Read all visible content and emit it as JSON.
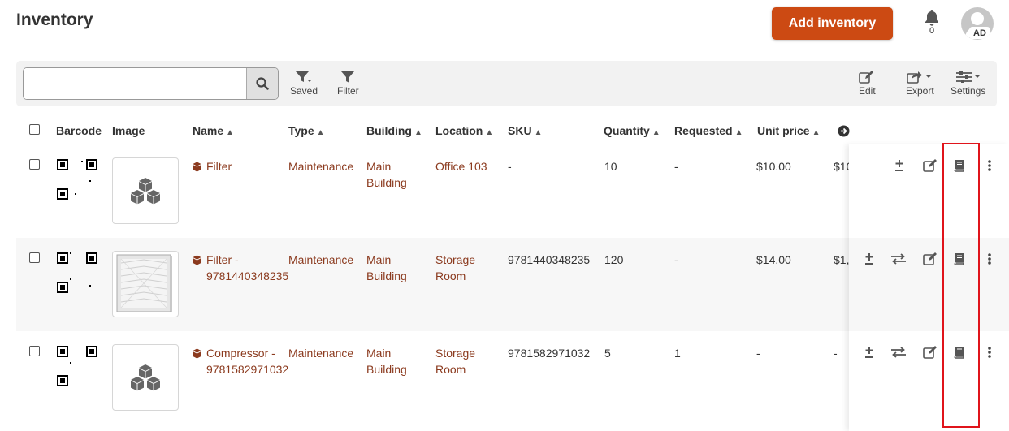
{
  "header": {
    "title": "Inventory",
    "add_button": "Add inventory",
    "notification_count": "0",
    "avatar_initials": "AD"
  },
  "toolbar": {
    "search_placeholder": "",
    "saved_label": "Saved",
    "filter_label": "Filter",
    "edit_label": "Edit",
    "export_label": "Export",
    "settings_label": "Settings"
  },
  "columns": [
    "Barcode",
    "Image",
    "Name",
    "Type",
    "Building",
    "Location",
    "SKU",
    "Quantity",
    "Requested",
    "Unit price"
  ],
  "rows": [
    {
      "name": "Filter",
      "type": "Maintenance",
      "building": "Main Building",
      "location": "Office 103",
      "sku": "-",
      "quantity": "10",
      "requested": "-",
      "unit_price": "$10.00",
      "total": "$10",
      "image": "placeholder-boxes"
    },
    {
      "name": "Filter - 9781440348235",
      "type": "Maintenance",
      "building": "Main Building",
      "location": "Storage Room",
      "sku": "9781440348235",
      "quantity": "120",
      "requested": "-",
      "unit_price": "$14.00",
      "total": "$1,",
      "image": "air-filter-photo"
    },
    {
      "name": "Compressor - 9781582971032",
      "type": "Maintenance",
      "building": "Main Building",
      "location": "Storage Room",
      "sku": "9781582971032",
      "quantity": "5",
      "requested": "1",
      "unit_price": "-",
      "total": "-",
      "image": "placeholder-boxes"
    }
  ],
  "colors": {
    "accent": "#cc4a13",
    "link": "#8b3a1e",
    "highlight": "#e0141b"
  }
}
